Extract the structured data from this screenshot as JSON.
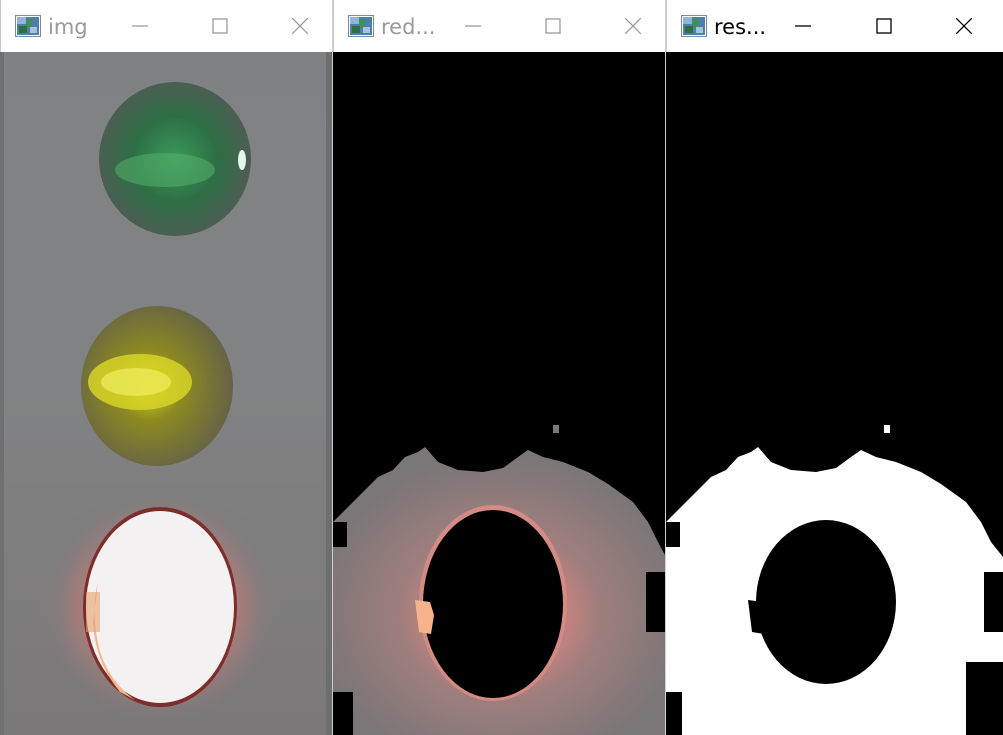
{
  "windows": [
    {
      "title": "img",
      "state": "inactive",
      "image": "traffic-light-photo",
      "controls": {
        "minimize": "minimize-icon",
        "maximize": "maximize-icon",
        "close": "close-icon"
      }
    },
    {
      "title": "red...",
      "state": "inactive",
      "image": "red-color-mask-overlay",
      "controls": {
        "minimize": "minimize-icon",
        "maximize": "maximize-icon",
        "close": "close-icon"
      }
    },
    {
      "title": "res...",
      "state": "active",
      "image": "binary-threshold-result",
      "controls": {
        "minimize": "minimize-icon",
        "maximize": "maximize-icon",
        "close": "close-icon"
      }
    }
  ],
  "colors": {
    "inactive_title": "#9a9a9a",
    "active_title": "#000000",
    "inactive_controls": "#9a9a9a",
    "active_controls": "#000000",
    "background": "#000000"
  }
}
